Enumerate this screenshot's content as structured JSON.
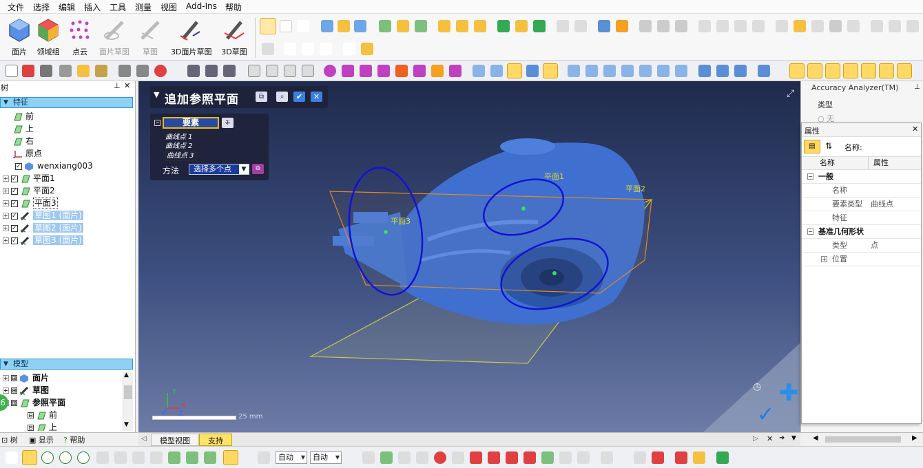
{
  "menubar": {
    "items": [
      "文件",
      "选择",
      "编辑",
      "插入",
      "工具",
      "测量",
      "视图",
      "Add-Ins",
      "帮助"
    ]
  },
  "ribbon": {
    "buttons": [
      {
        "label": "面片",
        "enabled": true
      },
      {
        "label": "领域组",
        "enabled": true
      },
      {
        "label": "点云",
        "enabled": true
      },
      {
        "label": "面片草图",
        "enabled": false
      },
      {
        "label": "草图",
        "enabled": false
      },
      {
        "label": "3D面片草图",
        "enabled": true
      },
      {
        "label": "3D草图",
        "enabled": true
      }
    ]
  },
  "tree_panel": {
    "title": "树",
    "features_header": "特征",
    "features": [
      {
        "label": "前"
      },
      {
        "label": "上"
      },
      {
        "label": "右"
      },
      {
        "label": "原点"
      },
      {
        "label": "wenxiang003"
      },
      {
        "label": "平面1"
      },
      {
        "label": "平面2"
      },
      {
        "label": "平面3"
      },
      {
        "label": "草图1 (面片)"
      },
      {
        "label": "草图2 (面片)"
      },
      {
        "label": "草图3 (面片)"
      }
    ],
    "model_header": "模型",
    "model_items": [
      {
        "label": "面片"
      },
      {
        "label": "草图"
      },
      {
        "label": "参照平面"
      },
      {
        "label": "前"
      },
      {
        "label": "上"
      }
    ]
  },
  "left_tabs": {
    "tree": "树",
    "display": "显示",
    "help": "帮助"
  },
  "dialog": {
    "title": "追加参照平面",
    "elements_label": "要素",
    "elements": [
      "曲线点 1",
      "曲线点 2",
      "曲线点 3"
    ],
    "method_label": "方法",
    "method_value": "选择多个点"
  },
  "viewport": {
    "plane_labels": [
      "平面1",
      "平面2",
      "平面3"
    ],
    "scale_text": "25 mm",
    "axis_x": "X",
    "axis_y": "Y",
    "axis_z": "Z",
    "badge": "6"
  },
  "view_tabs": {
    "model_view": "模型视图",
    "support": "支持"
  },
  "accuracy_panel": {
    "title": "Accuracy Analyzer(TM)",
    "type_label": "类型",
    "none_option": "无"
  },
  "properties_panel": {
    "title": "属性",
    "name_search_label": "名称:",
    "col_name": "名称",
    "col_value": "属性",
    "rows": [
      {
        "key": "一般",
        "value": "",
        "category": true
      },
      {
        "key": "名称",
        "value": "",
        "category": false
      },
      {
        "key": "要素类型",
        "value": "曲线点",
        "category": false
      },
      {
        "key": "特征",
        "value": "",
        "category": false
      },
      {
        "key": "基准几何形状",
        "value": "",
        "category": true
      },
      {
        "key": "类型",
        "value": "点",
        "category": false
      },
      {
        "key": "位置",
        "value": "",
        "category": false
      }
    ]
  },
  "statusbar": {
    "combo1": "自动",
    "combo2": "自动"
  },
  "colors": {
    "mesh": "#3d6fd0",
    "ellipse": "#1010d0",
    "plane_orange": "#e08a20",
    "plane_yellow": "#c8c84a",
    "highlight": "#8fd1f2"
  }
}
